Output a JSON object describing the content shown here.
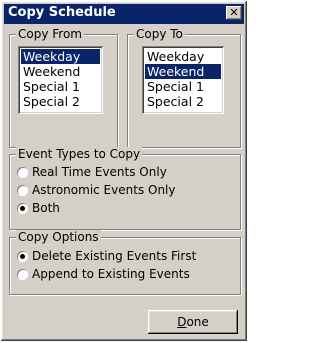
{
  "window": {
    "title": "Copy Schedule",
    "close_glyph": "✕"
  },
  "copy_from": {
    "legend": "Copy From",
    "items": [
      "Weekday",
      "Weekend",
      "Special 1",
      "Special 2"
    ],
    "selected_index": 0
  },
  "copy_to": {
    "legend": "Copy To",
    "items": [
      "Weekday",
      "Weekend",
      "Special 1",
      "Special 2"
    ],
    "selected_index": 1
  },
  "event_types": {
    "legend": "Event Types to Copy",
    "options": [
      "Real Time Events Only",
      "Astronomic Events Only",
      "Both"
    ],
    "selected_index": 2
  },
  "copy_options": {
    "legend": "Copy Options",
    "options": [
      "Delete Existing Events First",
      "Append to Existing Events"
    ],
    "selected_index": 0
  },
  "done_button": {
    "mnemonic": "D",
    "rest": "one"
  },
  "colors": {
    "title_bar": "#0a246a",
    "face": "#d4d0c8",
    "selection": "#0a246a"
  }
}
